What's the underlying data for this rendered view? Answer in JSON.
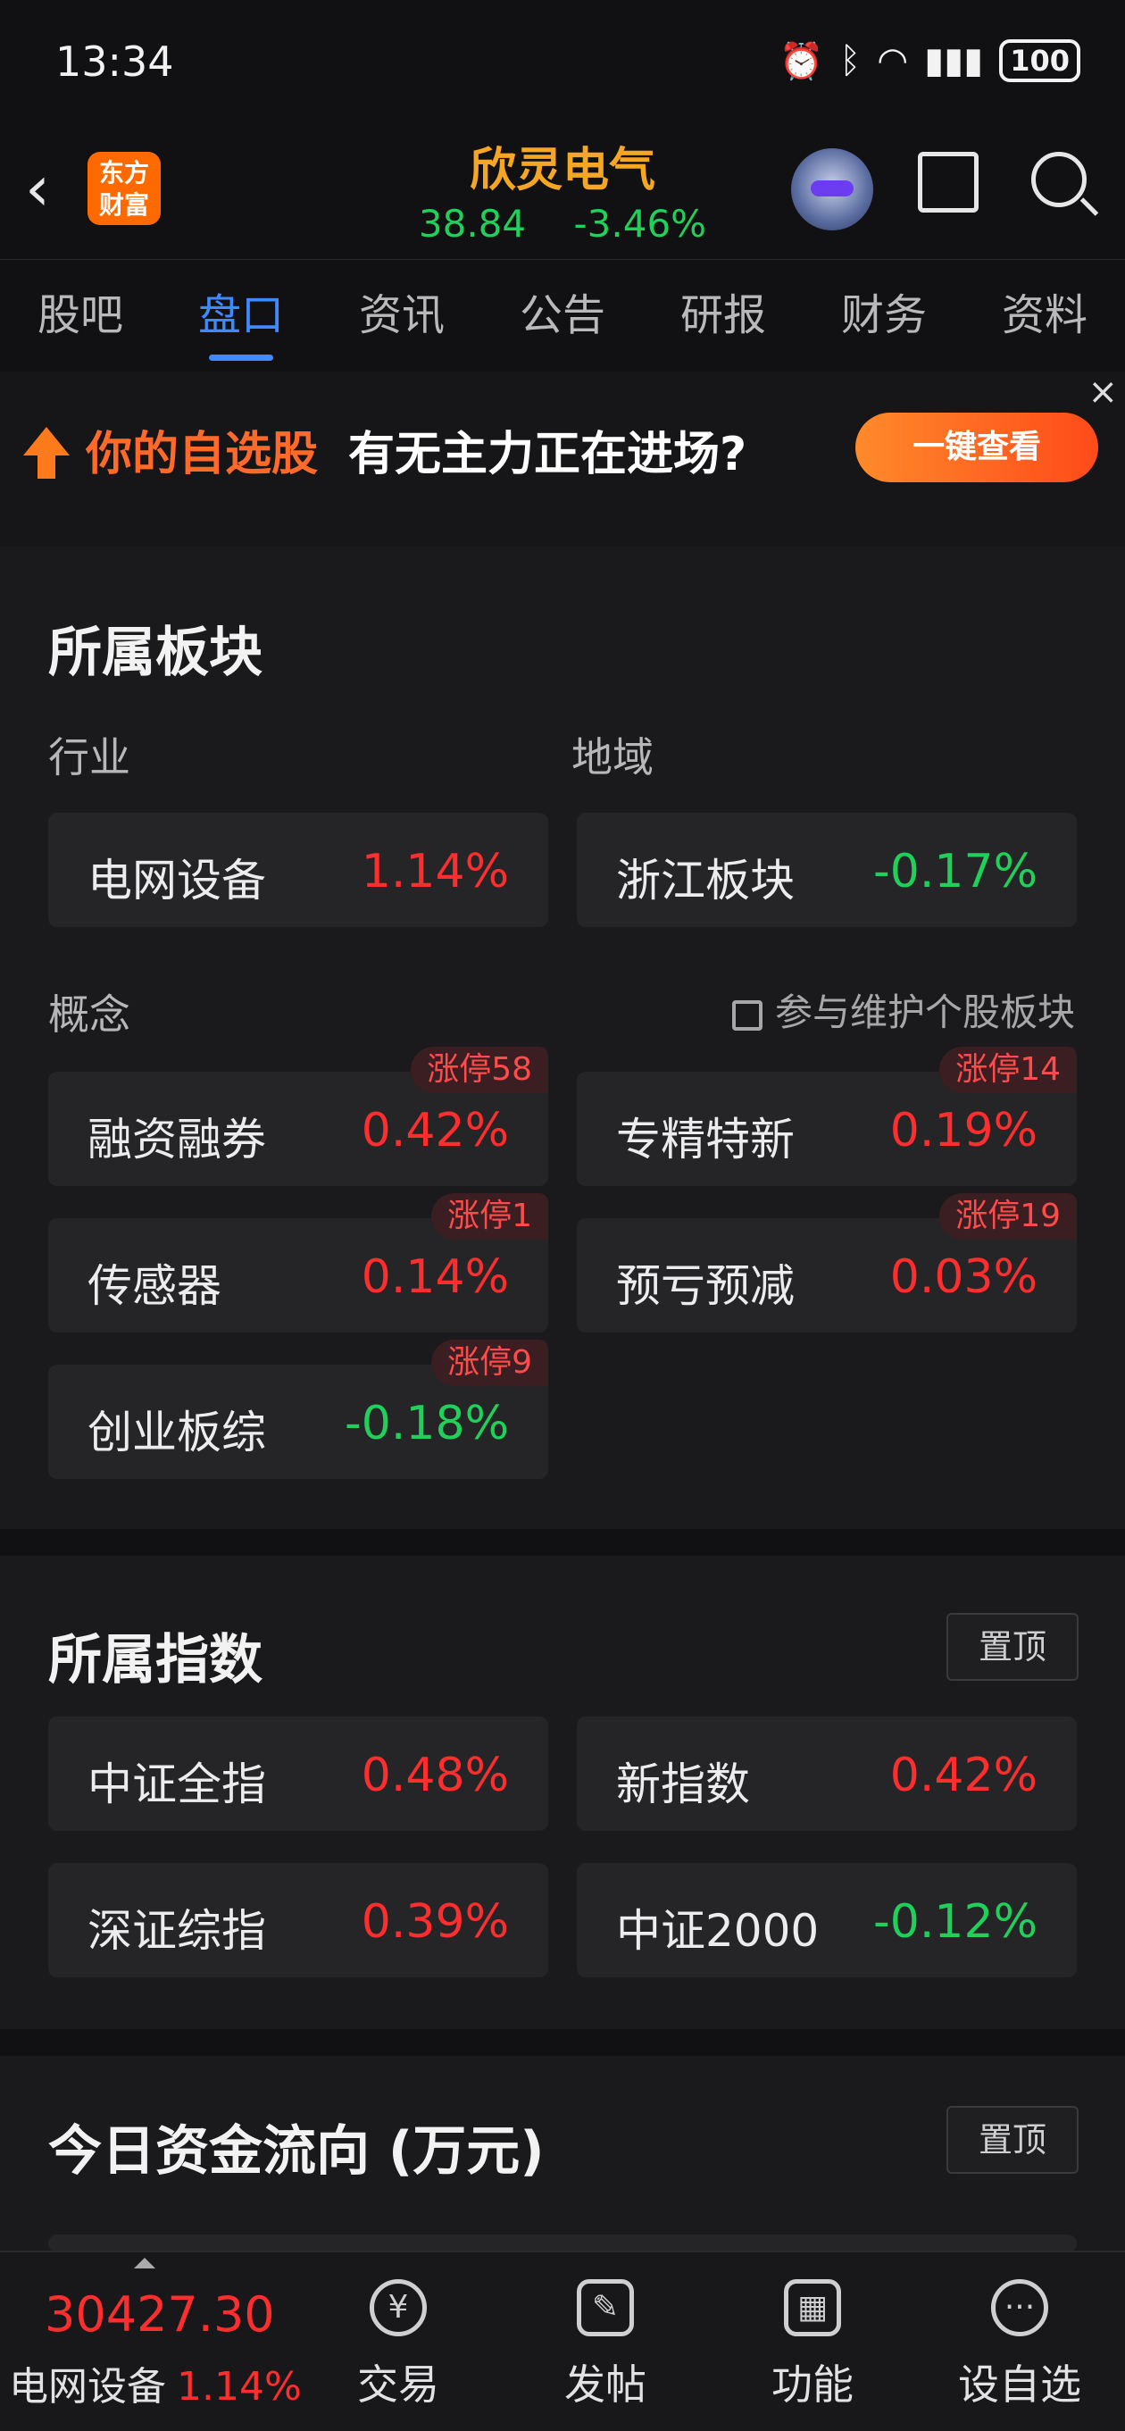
{
  "status_bar": {
    "time": "13:34",
    "battery": "100"
  },
  "header": {
    "stock_name": "欣灵电气",
    "price": "38.84",
    "change_pct": "-3.46%",
    "logo_line1": "东方",
    "logo_line2": "财富"
  },
  "tabs": [
    {
      "label": "股吧"
    },
    {
      "label": "盘口",
      "active": true
    },
    {
      "label": "资讯"
    },
    {
      "label": "公告"
    },
    {
      "label": "研报"
    },
    {
      "label": "财务"
    },
    {
      "label": "资料"
    }
  ],
  "banner": {
    "highlight": "你的自选股",
    "text": "有无主力正在进场?",
    "button": "一键查看",
    "close": "×"
  },
  "sectors": {
    "title": "所属板块",
    "industry_label": "行业",
    "region_label": "地域",
    "industry": {
      "name": "电网设备",
      "pct": "1.14%"
    },
    "region": {
      "name": "浙江板块",
      "pct": "-0.17%"
    },
    "concept_label": "概念",
    "maintain_link": "参与维护个股板块",
    "concepts": [
      {
        "name": "融资融券",
        "pct": "0.42%",
        "badge": "涨停58"
      },
      {
        "name": "专精特新",
        "pct": "0.19%",
        "badge": "涨停14"
      },
      {
        "name": "传感器",
        "pct": "0.14%",
        "badge": "涨停1"
      },
      {
        "name": "预亏预减",
        "pct": "0.03%",
        "badge": "涨停19"
      },
      {
        "name": "创业板综",
        "pct": "-0.18%",
        "badge": "涨停9"
      }
    ]
  },
  "indices": {
    "title": "所属指数",
    "pin": "置顶",
    "items": [
      {
        "name": "中证全指",
        "pct": "0.48%"
      },
      {
        "name": "新指数",
        "pct": "0.42%"
      },
      {
        "name": "深证综指",
        "pct": "0.39%"
      },
      {
        "name": "中证2000",
        "pct": "-0.12%"
      }
    ]
  },
  "fund_flow": {
    "title": "今日资金流向 (万元)",
    "pin": "置顶"
  },
  "bottom_bar": {
    "index_value": "30427.30",
    "index_name": "电网设备",
    "index_pct": "1.14%",
    "nav": [
      {
        "label": "交易",
        "icon": "yen-exchange-icon",
        "glyph": "¥"
      },
      {
        "label": "发帖",
        "icon": "edit-post-icon",
        "glyph": "✎"
      },
      {
        "label": "功能",
        "icon": "grid-icon",
        "glyph": "▦"
      },
      {
        "label": "设自选",
        "icon": "more-icon",
        "glyph": "···"
      }
    ]
  }
}
